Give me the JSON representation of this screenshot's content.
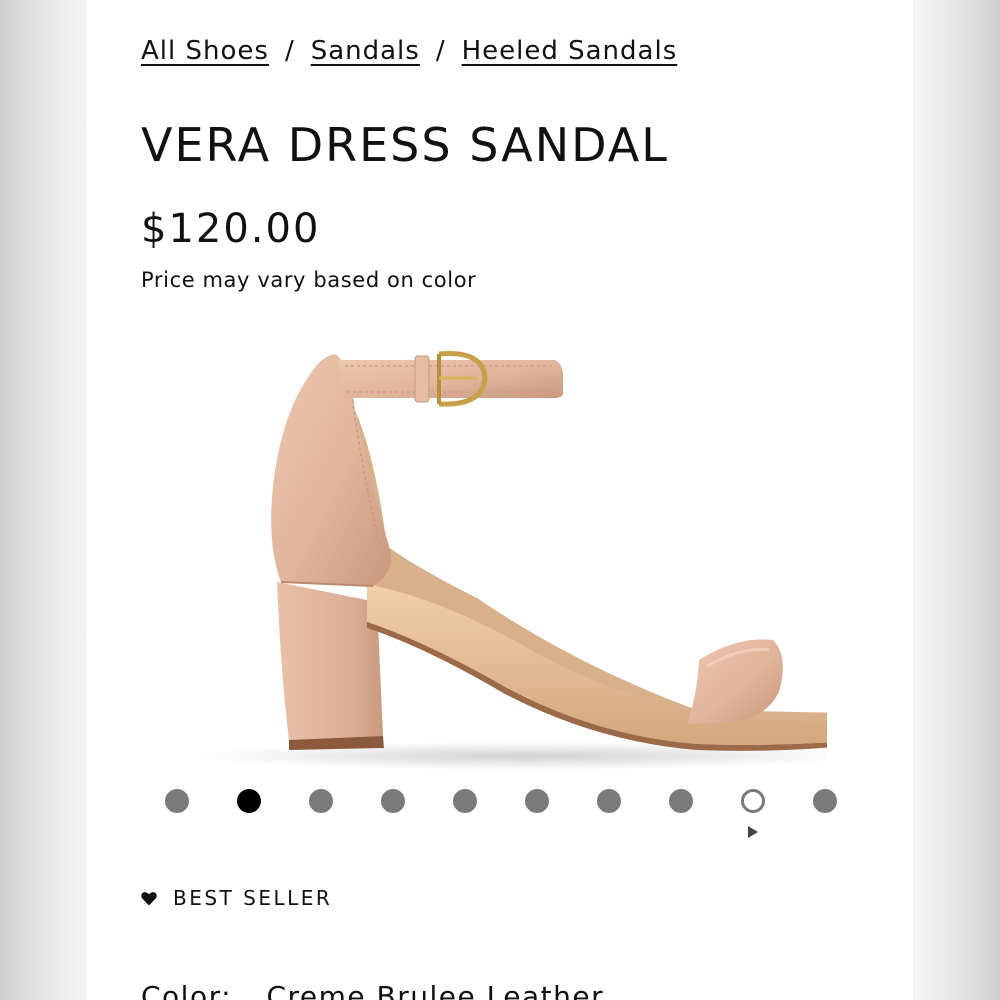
{
  "breadcrumb": {
    "items": [
      {
        "label": "All Shoes"
      },
      {
        "label": "Sandals"
      },
      {
        "label": "Heeled Sandals"
      }
    ],
    "separator": "/"
  },
  "product": {
    "name": "VERA DRESS SANDAL",
    "price": "$120.00",
    "price_note": "Price may vary based on color",
    "badge": {
      "label": "BEST SELLER",
      "icon": "heart-icon"
    },
    "color_label": "Color:",
    "color_value": "Creme Brulee Leather"
  },
  "gallery": {
    "image_alt": "Vera dress sandal, side view",
    "dot_count": 10,
    "active_index": 1,
    "video_index": 8,
    "play_icon": "play-icon"
  },
  "colors": {
    "text": "#111111",
    "dot": "#7a7a7a",
    "dot_active": "#000000",
    "sandal": "#e4b9a0"
  }
}
